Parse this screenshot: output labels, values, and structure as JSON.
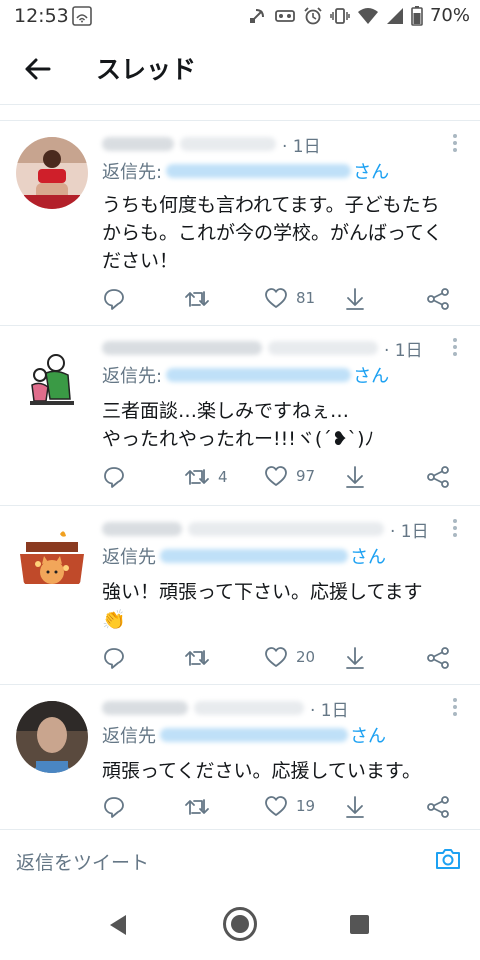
{
  "status": {
    "time": "12:53",
    "battery": "70%"
  },
  "header": {
    "title": "スレッド"
  },
  "tweets": [
    {
      "time": "· 1日",
      "reply_prefix": "返信先:",
      "reply_suffix": "さん",
      "text": "うちも何度も言われてます。子どもたち\nからも。これが今の学校。がんばってく\nださい！",
      "retweets": "",
      "likes": "81"
    },
    {
      "time": "· 1日",
      "reply_prefix": "返信先:",
      "reply_suffix": "さん",
      "text": "三者面談…楽しみですねぇ…\nやったれやったれー!!!ヾ(´❥`)ﾉ",
      "retweets": "4",
      "likes": "97"
    },
    {
      "time": "· 1日",
      "reply_prefix": "返信先",
      "reply_suffix": "さん",
      "text": "強い！頑張って下さい。応援してます\n👏",
      "retweets": "",
      "likes": "20"
    },
    {
      "time": "· 1日",
      "reply_prefix": "返信先",
      "reply_suffix": "さん",
      "text": "頑張ってください。応援しています。",
      "retweets": "",
      "likes": "19"
    }
  ],
  "compose": {
    "placeholder": "返信をツイート"
  },
  "colors": {
    "accent": "#1da1f2",
    "secondary_text": "#657786",
    "divider": "#e6ecf0"
  },
  "icons": [
    "back-arrow-icon",
    "reply-icon",
    "retweet-icon",
    "heart-icon",
    "download-icon",
    "share-icon",
    "more-icon",
    "camera-icon"
  ]
}
